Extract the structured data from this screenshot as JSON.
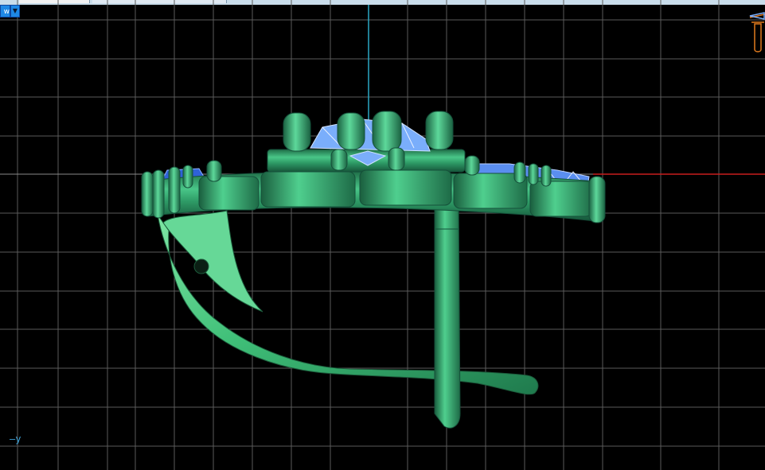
{
  "viewport": {
    "view_menu_label": "w",
    "axis_label": "y",
    "grid_color": "#5a5a5a",
    "axis_vertical_color": "#2aa8c4",
    "axis_horizontal_color": "#c81e1e",
    "metal_color": "#2e9b66",
    "gem_color": "#7aaefb",
    "model_icon": "orientation-gizmo-icon"
  }
}
